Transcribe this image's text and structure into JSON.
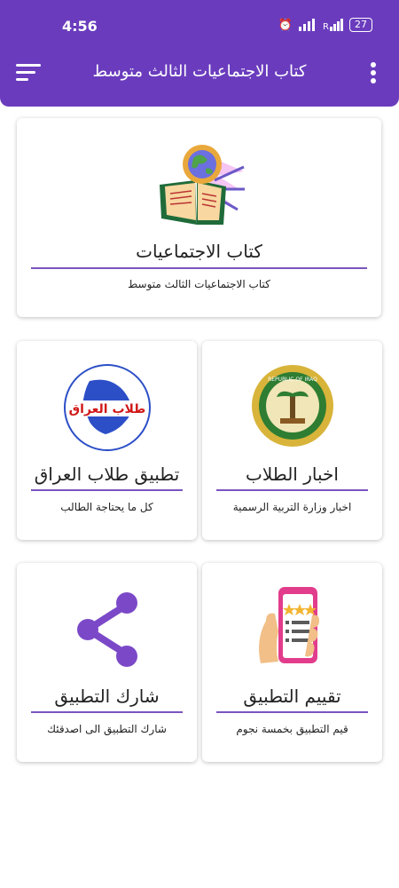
{
  "status": {
    "time": "4:56",
    "battery": "27"
  },
  "appbar": {
    "title": "كتاب الاجتماعيات الثالث متوسط"
  },
  "cards": [
    {
      "title": "كتاب الاجتماعيات",
      "subtitle": "كتاب الاجتماعيات الثالث متوسط",
      "icon": "globe-book-icon"
    },
    {
      "title": "اخبار الطلاب",
      "subtitle": "اخبار وزارة التربية الرسمية",
      "icon": "ministry-seal-icon"
    },
    {
      "title": "تطبيق طلاب العراق",
      "subtitle": "كل ما يحتاجة الطالب",
      "icon": "iraq-map-logo",
      "logo_text": "طلاب العراق"
    },
    {
      "title": "تقييم التطبيق",
      "subtitle": "قيم التطبيق بخمسة نجوم",
      "icon": "rating-phone-icon"
    },
    {
      "title": "شارك التطبيق",
      "subtitle": "شارك التطبيق الى اصدقئك",
      "icon": "share-icon"
    }
  ],
  "colors": {
    "primary": "#6a3cbd",
    "accent": "#7a55c0",
    "share": "#7b49c8"
  }
}
